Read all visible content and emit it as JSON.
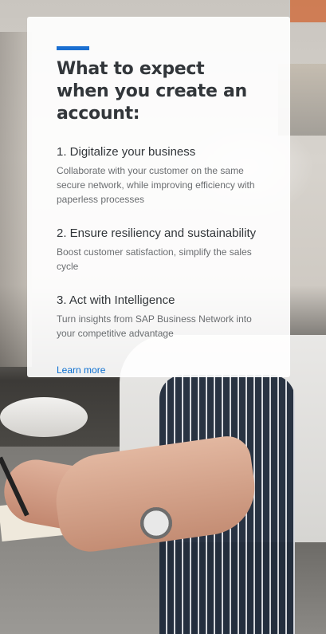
{
  "card": {
    "heading": "What to expect when you create an account:",
    "items": [
      {
        "title": "1. Digitalize your business",
        "description": "Collaborate with your customer on the same secure network, while improving efficiency with paperless processes"
      },
      {
        "title": "2. Ensure resiliency and sustainability",
        "description": "Boost customer satisfaction, simplify the sales cycle"
      },
      {
        "title": "3. Act with Intelligence",
        "description": "Turn insights from SAP Business Network into your competitive advantage"
      }
    ],
    "learn_more_label": "Learn more"
  },
  "colors": {
    "accent": "#1a6fd1",
    "link": "#0a6ed1",
    "heading_text": "#32363a",
    "body_text": "#6a6d70"
  }
}
